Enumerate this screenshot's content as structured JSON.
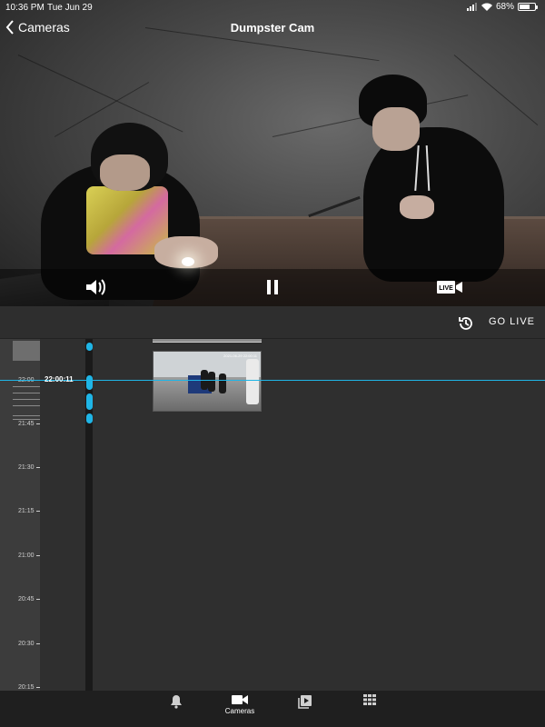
{
  "status_bar": {
    "time": "10:36 PM",
    "date": "Tue Jun 29",
    "battery": "68%",
    "battery_level": 0.68
  },
  "nav": {
    "back_label": "Cameras",
    "title": "Dumpster Cam"
  },
  "video_controls": {
    "live_badge": "LIVE"
  },
  "toolbar": {
    "go_live_label": "GO LIVE"
  },
  "timeline": {
    "cursor_time": "22:00:11",
    "ticks": [
      "22:00",
      "21:45",
      "21:30",
      "21:15",
      "21:00",
      "20:45",
      "20:30",
      "20:15"
    ],
    "thumbnail_timestamp": "2021-06-29 22:00:11"
  },
  "tabbar": {
    "cameras_label": "Cameras"
  },
  "colors": {
    "accent": "#1fb5e6",
    "background": "#2f2f2f",
    "tabbar": "#1f1f1f"
  }
}
